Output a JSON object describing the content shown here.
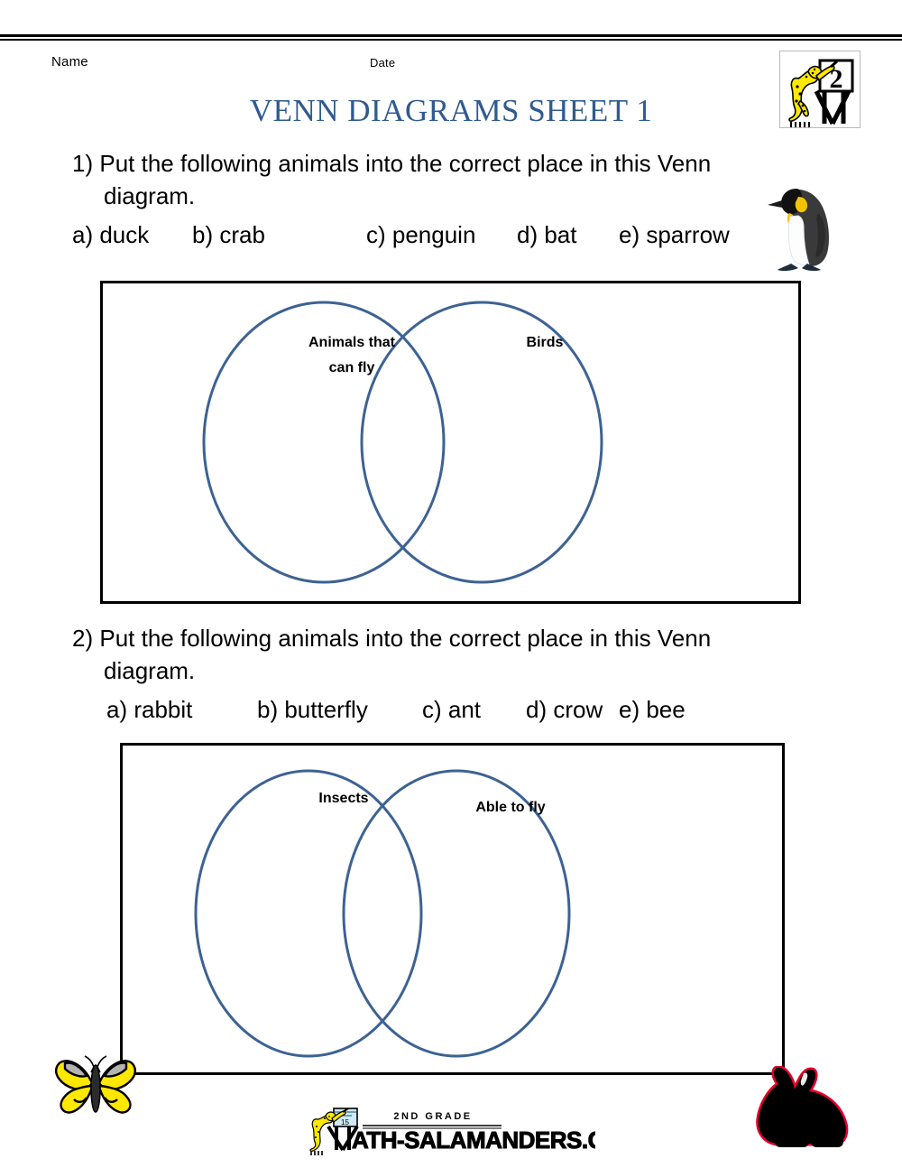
{
  "page": {
    "name_label": "Name",
    "date_label": "Date",
    "title": "VENN DIAGRAMS SHEET 1"
  },
  "badge": {
    "icon": "salamander-easel-logo",
    "number": "2"
  },
  "questions": [
    {
      "number": "1)",
      "prompt_line1": "Put the following animals into the correct place in this Venn",
      "prompt_line2": "diagram.",
      "options": [
        "a) duck",
        "b) crab",
        "c) penguin",
        "d) bat",
        "e) sparrow"
      ]
    },
    {
      "number": "2)",
      "prompt_line1": "Put the following animals into the correct place in this Venn",
      "prompt_line2": "diagram.",
      "options": [
        "a) rabbit",
        "b) butterfly",
        "c) ant",
        "d) crow",
        "e) bee"
      ]
    }
  ],
  "venn_diagrams": [
    {
      "left_label_line1": "Animals that",
      "left_label_line2": "can fly",
      "right_label": "Birds",
      "circle_color": "#3d6293",
      "border_color": "#000000"
    },
    {
      "left_label_line1": "Insects",
      "left_label_line2": "",
      "right_label": "Able to fly",
      "circle_color": "#3d6293",
      "border_color": "#000000"
    }
  ],
  "artwork": [
    {
      "name": "penguin-illustration"
    },
    {
      "name": "butterfly-illustration"
    },
    {
      "name": "rabbit-illustration"
    }
  ],
  "footer": {
    "grade_text": "2ND GRADE",
    "site_text": "MATH-SALAMANDERS.COM",
    "icon": "salamander-easel-logo"
  },
  "colors": {
    "title_blue": "#2f5b8f",
    "venn_stroke": "#3d6293",
    "salamander_yellow": "#ffe800",
    "rabbit_outline_red": "#e4002b"
  }
}
